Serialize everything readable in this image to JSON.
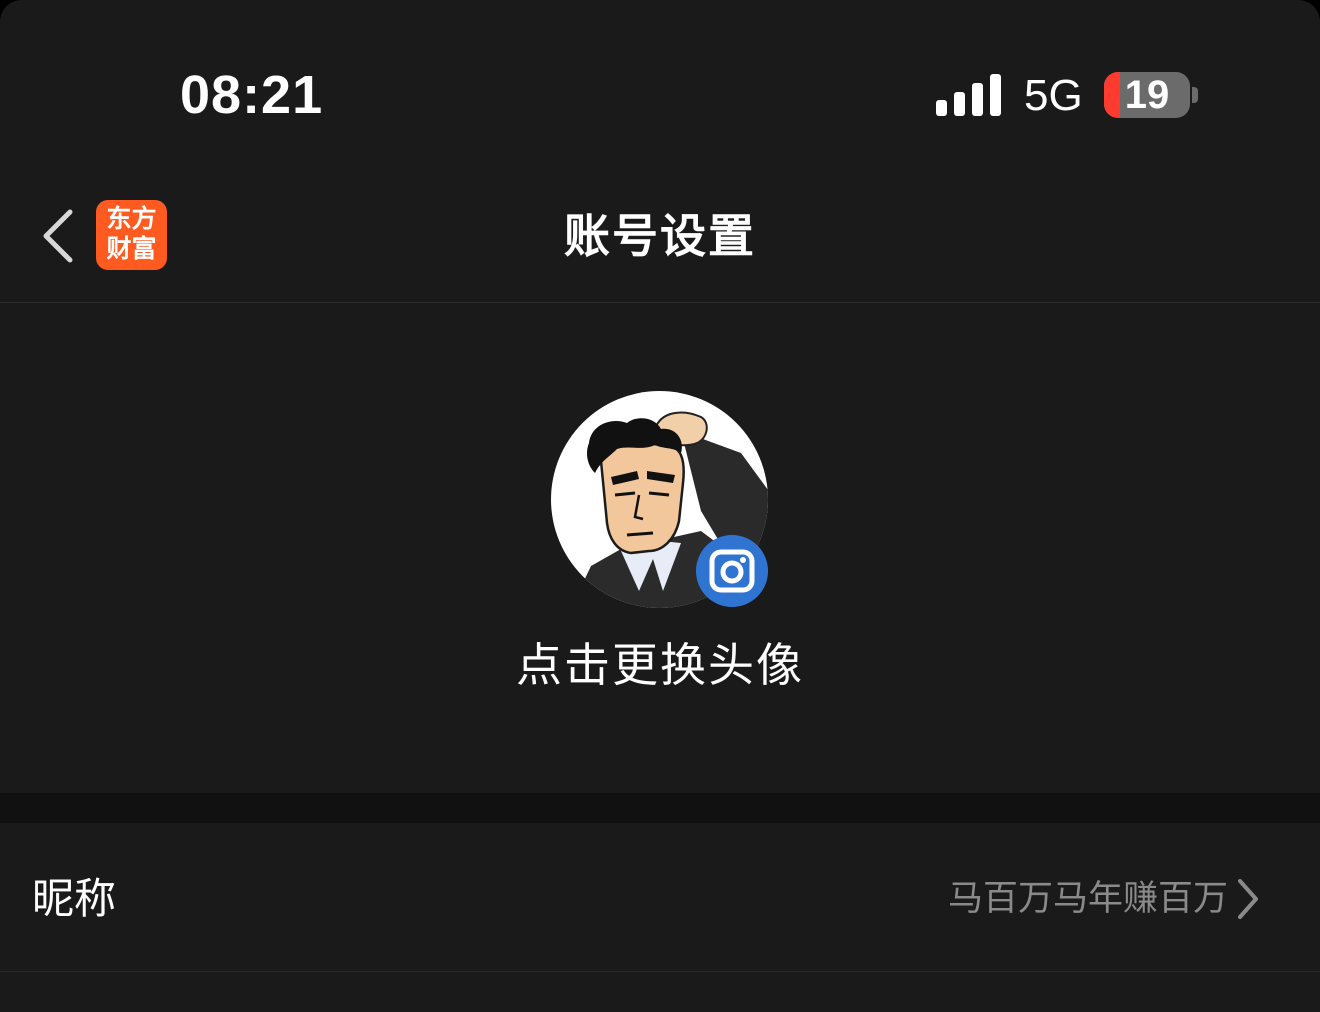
{
  "status_bar": {
    "time": "08:21",
    "network": "5G",
    "battery": "19",
    "battery_level_percent": 19,
    "battery_accent": "#ff3b30",
    "signal_bars": 4
  },
  "nav": {
    "title": "账号设置",
    "logo_line1": "东方",
    "logo_line2": "财富",
    "logo_color": "#ff5a1f"
  },
  "avatar": {
    "change_label": "点击更换头像",
    "badge_color": "#2f74d0"
  },
  "settings": [
    {
      "label": "昵称",
      "value": "马百万马年赚百万"
    }
  ],
  "colors": {
    "background": "#1a1a1a",
    "divider_band": "#111111",
    "text_primary": "#ffffff",
    "text_secondary": "#8a8a8a"
  }
}
